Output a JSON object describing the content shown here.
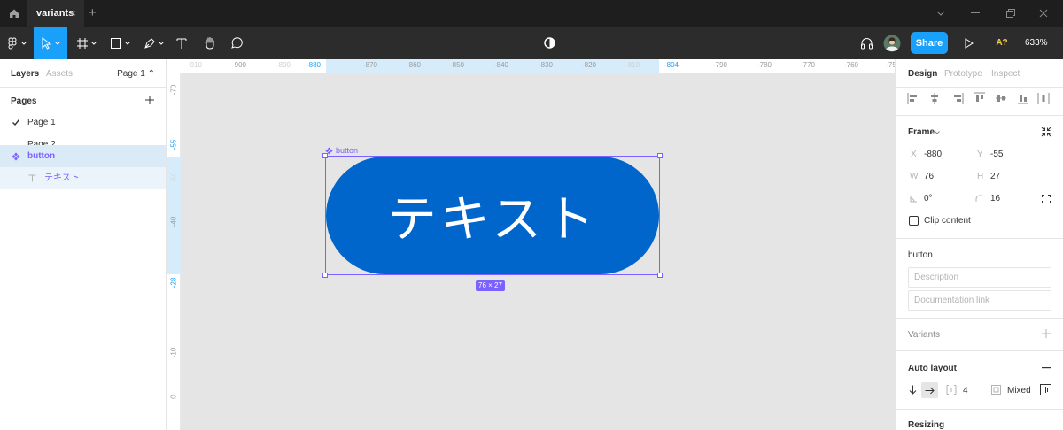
{
  "titlebar": {
    "tab_label": "variants",
    "tab_close": "×",
    "new_tab": "+"
  },
  "toolbar": {
    "share_label": "Share",
    "zoom_label": "633%",
    "zoom_chevron": "⌄",
    "accessibility_label": "A?"
  },
  "left_panel": {
    "tab_layers": "Layers",
    "tab_assets": "Assets",
    "page_selector": "Page 1 ⌃",
    "pages_heading": "Pages",
    "pages": [
      {
        "label": "Page 1",
        "current": true
      },
      {
        "label": "Page 2",
        "current": false
      }
    ],
    "layers": [
      {
        "label": "button",
        "icon": "component-icon"
      },
      {
        "label": "テキスト",
        "icon": "text-icon"
      }
    ]
  },
  "ruler": {
    "top_ticks": [
      "-910",
      "-900",
      "-890",
      "-880",
      "-870",
      "-860",
      "-850",
      "-840",
      "-830",
      "-820",
      "-810",
      "-804",
      "-790",
      "-780",
      "-770",
      "-760",
      "-75"
    ],
    "left_ticks": [
      "-70",
      "-55",
      "-50",
      "-40",
      "-28",
      "-10",
      "0"
    ]
  },
  "canvas": {
    "frame_label": "button",
    "button_text": "テキスト",
    "dims_label": "76 × 27",
    "button_color": "#0066cc",
    "selection_color": "#7b61ff"
  },
  "right_panel": {
    "tabs": [
      "Design",
      "Prototype",
      "Inspect"
    ],
    "frame_heading": "Frame",
    "x_label": "X",
    "x_value": "-880",
    "y_label": "Y",
    "y_value": "-55",
    "w_label": "W",
    "w_value": "76",
    "h_label": "H",
    "h_value": "27",
    "rotation_value": "0°",
    "radius_value": "16",
    "clip_content_label": "Clip content",
    "component_name": "button",
    "description_placeholder": "Description",
    "doc_link_placeholder": "Documentation link",
    "variants_label": "Variants",
    "auto_layout_label": "Auto layout",
    "spacing_value": "4",
    "padding_value": "Mixed",
    "resizing_label": "Resizing"
  }
}
